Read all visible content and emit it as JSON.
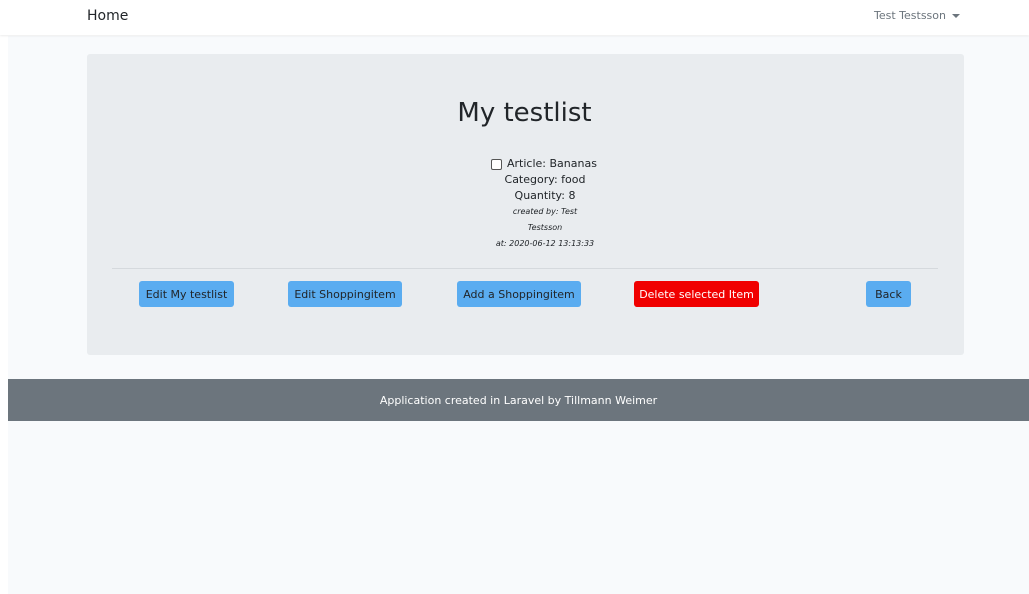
{
  "navbar": {
    "home_label": "Home",
    "user_label": "Test Testsson"
  },
  "main": {
    "title": "My testlist",
    "item": {
      "article": "Article: Bananas",
      "category": "Category: food",
      "quantity": "Quantity: 8",
      "created_by": "created by: Test Testsson",
      "created_at": "at: 2020-06-12 13:13:33",
      "checked": false
    },
    "buttons": {
      "edit_list": "Edit My testlist",
      "edit_item": "Edit Shoppingitem",
      "add_item": "Add a Shoppingitem",
      "delete_selected": "Delete selected Item",
      "back": "Back"
    }
  },
  "footer": {
    "text": "Application created in Laravel by Tillmann Weimer"
  },
  "colors": {
    "primary_button": "#5aacf0",
    "danger_button": "#f00000",
    "footer_bg": "#6c757d",
    "card_bg": "#e9ecef"
  }
}
